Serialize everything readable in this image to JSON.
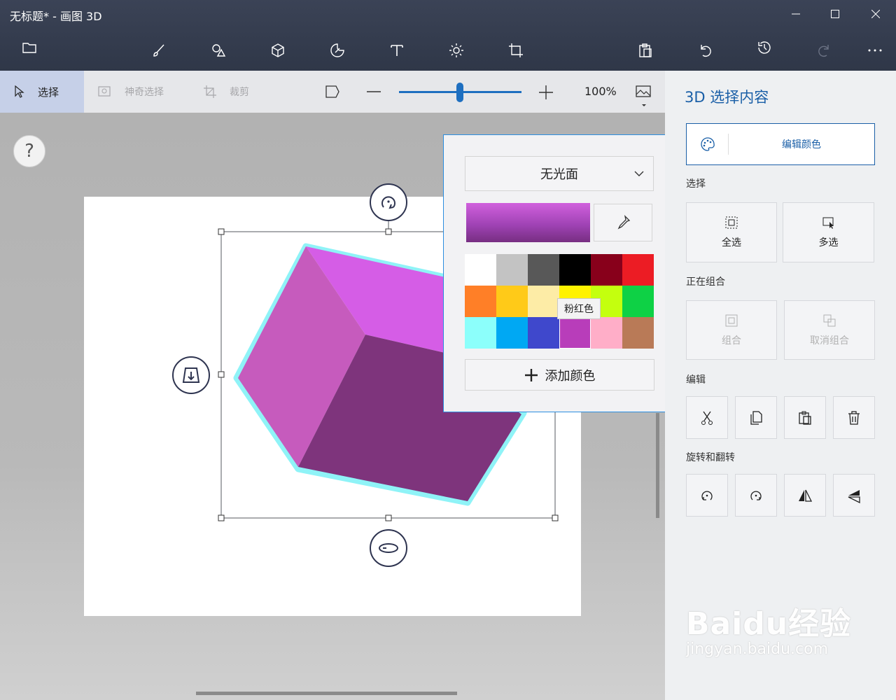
{
  "window": {
    "title": "无标题* - 画图 3D"
  },
  "toolbar": {
    "icons": [
      "folder-icon",
      "brush-icon",
      "2d-shapes-icon",
      "3d-shapes-icon",
      "stickers-icon",
      "text-icon",
      "effects-icon",
      "canvas-icon",
      "paste-icon",
      "undo-icon",
      "history-icon",
      "redo-icon",
      "more-icon"
    ]
  },
  "subbar": {
    "select_label": "选择",
    "magic_select_label": "神奇选择",
    "crop_label": "裁剪",
    "zoom_value": "100%",
    "zoom_level_percent": 100
  },
  "canvas": {
    "help_label": "?"
  },
  "color_popup": {
    "finish_value": "无光面",
    "current_color": "#a043b5",
    "palette": [
      "#ffffff",
      "#c3c3c3",
      "#585858",
      "#000000",
      "#88001b",
      "#ec1c24",
      "#ff7f27",
      "#ffca18",
      "#fdeca6",
      "#fff200",
      "#c4ff0e",
      "#0ed145",
      "#8cfffb",
      "#00a8f3",
      "#3f48cc",
      "#b83dba",
      "#ffaec8",
      "#b97a57"
    ],
    "selected_index": 15,
    "tooltip": "粉红色",
    "add_color_label": "添加颜色"
  },
  "right_panel": {
    "title": "3D 选择内容",
    "edit_color_label": "编辑颜色",
    "section_select": "选择",
    "select_all": "全选",
    "multi_select": "多选",
    "section_group": "正在组合",
    "group": "组合",
    "ungroup": "取消组合",
    "section_edit": "编辑",
    "section_rotate": "旋转和翻转"
  },
  "watermark": {
    "logo": "Baidu经验",
    "sub": "jingyan.baidu.com"
  },
  "colors": {
    "accent": "#1a5fa7",
    "cube_top": "#d55de6",
    "cube_left": "#c65bbd",
    "cube_right": "#7e347c",
    "glow": "#8ff3f7"
  }
}
